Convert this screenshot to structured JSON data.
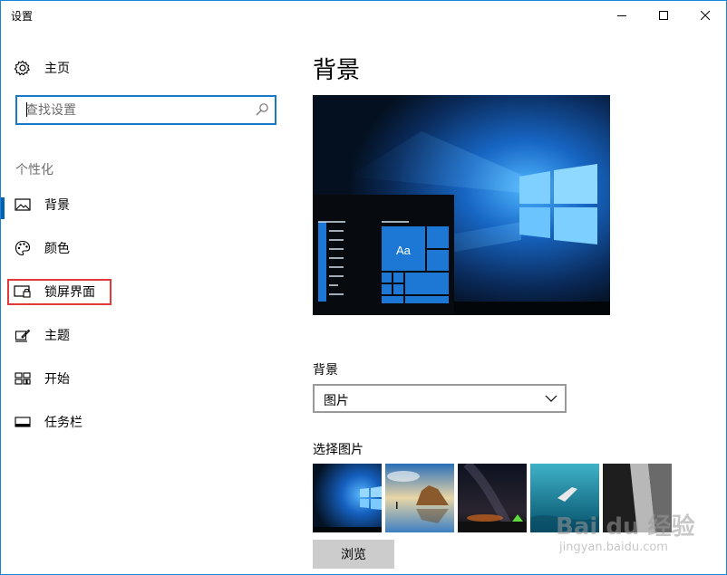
{
  "window": {
    "title": "设置"
  },
  "sidebar": {
    "home_label": "主页",
    "search_placeholder": "查找设置",
    "section_label": "个性化",
    "items": [
      {
        "label": "背景",
        "icon": "picture-icon",
        "selected": true
      },
      {
        "label": "颜色",
        "icon": "palette-icon",
        "selected": false
      },
      {
        "label": "锁屏界面",
        "icon": "lock-screen-icon",
        "selected": false
      },
      {
        "label": "主题",
        "icon": "theme-brush-icon",
        "selected": false
      },
      {
        "label": "开始",
        "icon": "start-tiles-icon",
        "selected": false
      },
      {
        "label": "任务栏",
        "icon": "taskbar-icon",
        "selected": false
      }
    ]
  },
  "content": {
    "title": "背景",
    "preview": {
      "tile_text": "Aa"
    },
    "background_label": "背景",
    "background_value": "图片",
    "choose_label": "选择图片",
    "thumbnails": [
      "windows-hero-wallpaper",
      "beach-rock-sunset",
      "night-sky-tent",
      "underwater-swimmer",
      "rock-cliff"
    ],
    "browse_label": "浏览"
  },
  "watermark": {
    "brand": "Bai du 经验",
    "url": "jingyan.baidu.com"
  },
  "colors": {
    "accent": "#0078d7",
    "selection_bar": "#0063b1",
    "highlight_box": "#e23a3a",
    "window_border": "#1883d7"
  }
}
